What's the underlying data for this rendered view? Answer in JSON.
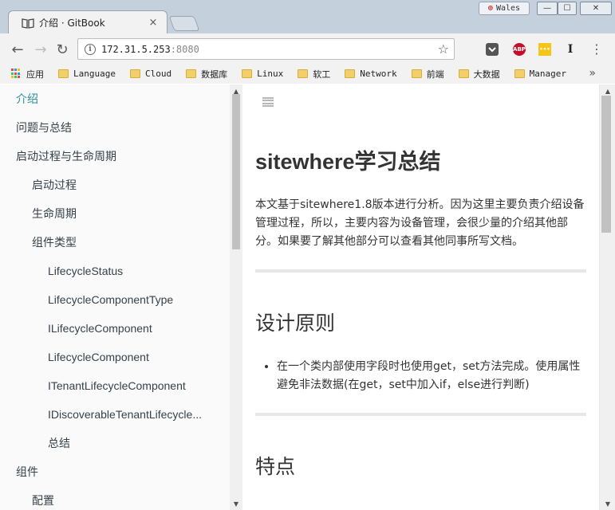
{
  "window": {
    "tab_title": "介绍 · GitBook",
    "tab_close": "×",
    "user_name": "Wales",
    "min_label": "—",
    "max_label": "☐",
    "close_label": "✕"
  },
  "toolbar": {
    "back": "←",
    "forward": "→",
    "reload": "↻",
    "info_label": "i",
    "url_host": "172.31.5.253",
    "url_port": ":8080",
    "star": "☆",
    "menu": "⋮",
    "ext_abp": "ABP",
    "ext_yellow": "•••",
    "ext_i": "I"
  },
  "bookmarks": {
    "apps_label": "应用",
    "items": [
      "Language",
      "Cloud",
      "数据库",
      "Linux",
      "软工",
      "Network",
      "前端",
      "大数据",
      "Manager"
    ],
    "more": "»"
  },
  "sidebar": {
    "items": [
      {
        "label": "介绍",
        "level": 0,
        "active": true
      },
      {
        "label": "问题与总结",
        "level": 0
      },
      {
        "label": "启动过程与生命周期",
        "level": 0
      },
      {
        "label": "启动过程",
        "level": 1
      },
      {
        "label": "生命周期",
        "level": 1
      },
      {
        "label": "组件类型",
        "level": 1
      },
      {
        "label": "LifecycleStatus",
        "level": 2
      },
      {
        "label": "LifecycleComponentType",
        "level": 2
      },
      {
        "label": "ILifecycleComponent",
        "level": 2
      },
      {
        "label": "LifecycleComponent",
        "level": 2
      },
      {
        "label": "ITenantLifecycleComponent",
        "level": 2
      },
      {
        "label": "IDiscoverableTenantLifecycle...",
        "level": 2
      },
      {
        "label": "总结",
        "level": 2
      },
      {
        "label": "组件",
        "level": 0
      },
      {
        "label": "配置",
        "level": 1
      }
    ]
  },
  "content": {
    "title": "sitewhere学习总结",
    "intro": "本文基于sitewhere1.8版本进行分析。因为这里主要负责介绍设备管理过程，所以，主要内容为设备管理，会很少量的介绍其他部分。如果要了解其他部分可以查看其他同事所写文档。",
    "section1_title": "设计原则",
    "section1_bullets": [
      "在一个类内部使用字段时也使用get，set方法完成。使用属性避免非法数据(在get，set中加入if，else进行判断)"
    ],
    "section2_title": "特点"
  },
  "colors": {
    "active_link": "#2e8fa0",
    "abp_red": "#c70d2c"
  }
}
